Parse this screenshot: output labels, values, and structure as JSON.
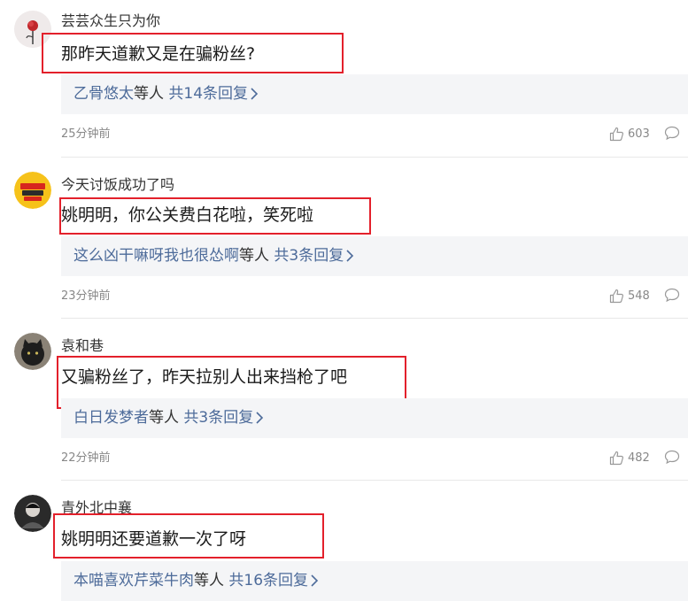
{
  "comments": [
    {
      "username": "芸芸众生只为你",
      "content": "那昨天道歉又是在骗粉丝?",
      "reply_names": "乙骨悠太",
      "reply_suffix": "等人",
      "reply_count": "共14条回复",
      "time": "25分钟前",
      "likes": "603",
      "avatar_icon": "rose-avatar-icon"
    },
    {
      "username": "今天讨饭成功了吗",
      "content": "姚明明，你公关费白花啦，笑死啦",
      "reply_names": "这么凶干嘛呀我也很怂啊",
      "reply_suffix": "等人",
      "reply_count": "共3条回复",
      "time": "23分钟前",
      "likes": "548",
      "avatar_icon": "sticker-avatar-icon"
    },
    {
      "username": "袁和巷",
      "content": "又骗粉丝了，昨天拉别人出来挡枪了吧",
      "reply_names": "白日发梦者",
      "reply_suffix": "等人",
      "reply_count": "共3条回复",
      "time": "22分钟前",
      "likes": "482",
      "avatar_icon": "black-cat-avatar-icon"
    },
    {
      "username": "青外北中襄",
      "content": "姚明明还要道歉一次了呀",
      "reply_names": "本喵喜欢芹菜牛肉",
      "reply_suffix": "等人",
      "reply_count": "共16条回复",
      "time": "",
      "likes": "",
      "avatar_icon": "person-avatar-icon"
    }
  ],
  "colors": {
    "highlight": "#e3202b",
    "reply_link": "#4d6b9a",
    "reply_bg": "#f4f5f7"
  }
}
